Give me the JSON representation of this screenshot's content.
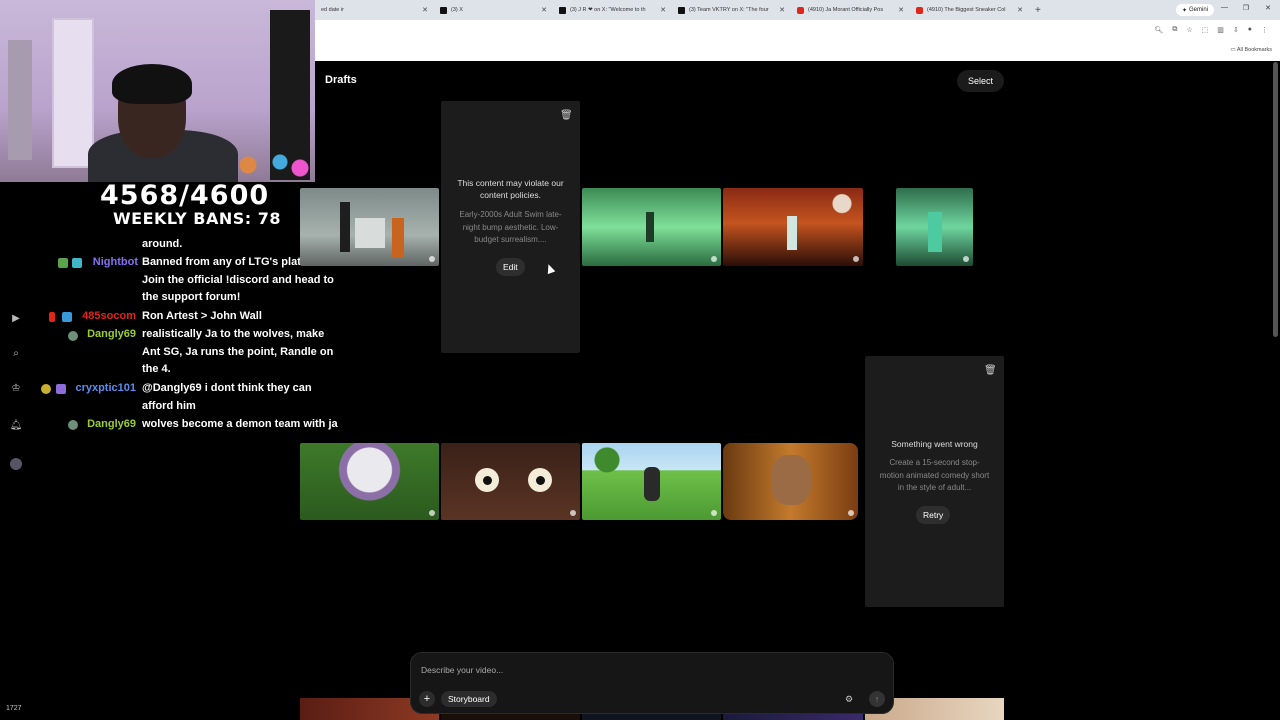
{
  "browser": {
    "tabs": [
      {
        "title": "ed date ir",
        "favicon": "page-icon"
      },
      {
        "title": "(3) X",
        "favicon": "x-icon"
      },
      {
        "title": "(3) J R ❤ on X: \"Welcome to th",
        "favicon": "x-icon"
      },
      {
        "title": "(3) Team VKTRY on X: \"The four",
        "favicon": "x-icon"
      },
      {
        "title": "(4910) Ja Morant Officially Pos",
        "favicon": "youtube-icon"
      },
      {
        "title": "(4910) The Biggest Sneaker Col",
        "favicon": "youtube-icon"
      }
    ],
    "gemini_label": "Gemini",
    "bookmarks_label": "All Bookmarks"
  },
  "overlay": {
    "counter": "4568/4600",
    "weekly_bans": "WEEKLY BANS: 78",
    "viewers": "1727"
  },
  "chat": [
    {
      "user": "",
      "text": "around.",
      "color": "#ffffff"
    },
    {
      "user": "Nightbot",
      "text": "Banned from any of LTG's platforms? Join the official !discord and head to the support forum!",
      "color": "#8a6ff0"
    },
    {
      "user": "485socom",
      "text": "Ron Artest > John Wall",
      "color": "#e0251b"
    },
    {
      "user": "Dangly69",
      "text": "realistically Ja to the wolves, make Ant SG, Ja runs the point, Randle on the 4.",
      "color": "#9acd32"
    },
    {
      "user": "cryxptic101",
      "text": "@Dangly69 i dont think they can afford him",
      "color": "#5b8def"
    },
    {
      "user": "Dangly69",
      "text": "wolves become a demon team with ja",
      "color": "#9acd32"
    }
  ],
  "page": {
    "title": "Drafts",
    "select_label": "Select"
  },
  "cards": {
    "violation": {
      "message": "This content may violate our content policies.",
      "prompt": "Early-2000s Adult Swim late-night bump aesthetic. Low-budget surrealism....",
      "action": "Edit"
    },
    "error": {
      "message": "Something went wrong",
      "prompt": "Create a 15-second stop-motion animated comedy short in the style of adult...",
      "action": "Retry"
    }
  },
  "composer": {
    "placeholder": "Describe your video...",
    "add_label": "+",
    "storyboard_label": "Storyboard"
  }
}
